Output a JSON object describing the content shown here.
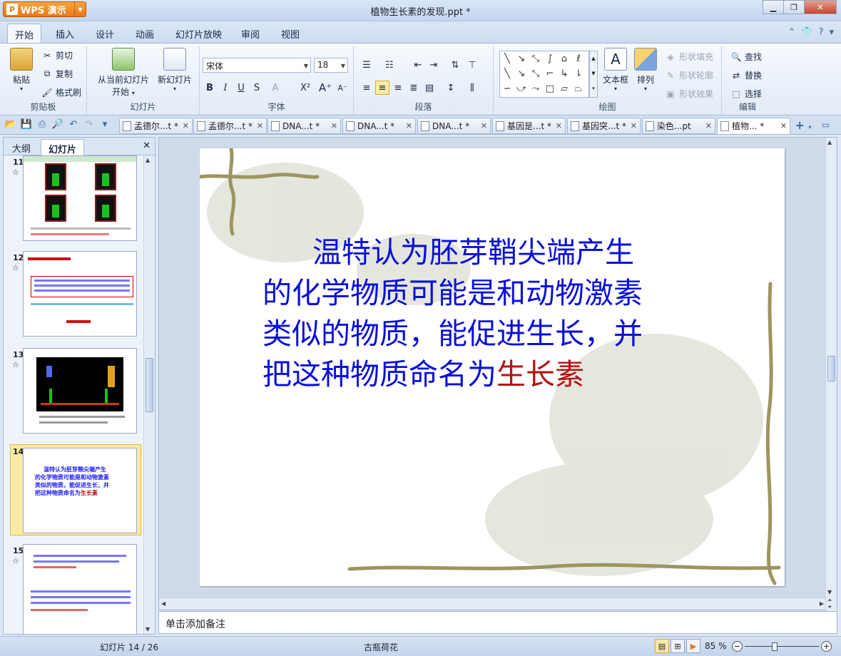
{
  "app": {
    "brand": "WPS 演示",
    "window_title": "植物生长素的发现.ppt *"
  },
  "ribbon_tabs": [
    "开始",
    "插入",
    "设计",
    "动画",
    "幻灯片放映",
    "审阅",
    "视图"
  ],
  "ribbon": {
    "clipboard": {
      "paste": "粘贴",
      "cut": "剪切",
      "copy": "复制",
      "format_painter": "格式刷",
      "label": "剪贴板"
    },
    "slides": {
      "from_current": "从当前幻灯片",
      "start": "开始",
      "new_slide": "新幻灯片",
      "label": "幻灯片"
    },
    "font": {
      "name": "宋体",
      "size": "18",
      "label": "字体"
    },
    "paragraph": {
      "label": "段落"
    },
    "drawing": {
      "textbox": "文本框",
      "arrange": "排列",
      "shape_fill": "形状填充",
      "shape_outline": "形状轮廓",
      "shape_effect": "形状效果",
      "label": "绘图"
    },
    "editing": {
      "find": "查找",
      "replace": "替换",
      "select": "选择",
      "label": "编辑"
    }
  },
  "doc_tabs": [
    {
      "label": "孟德尔...t *"
    },
    {
      "label": "孟德尔...t *"
    },
    {
      "label": "DNA...t *"
    },
    {
      "label": "DNA...t *"
    },
    {
      "label": "DNA...t *"
    },
    {
      "label": "基因是...t *"
    },
    {
      "label": "基因突...t *"
    },
    {
      "label": "染色...pt"
    },
    {
      "label": "植物... *"
    }
  ],
  "panel": {
    "tabs": [
      "大纲",
      "幻灯片"
    ]
  },
  "thumbnails": [
    {
      "number": "11",
      "star": "☆"
    },
    {
      "number": "12",
      "star": "☆"
    },
    {
      "number": "13",
      "star": "☆"
    },
    {
      "number": "14",
      "star": ""
    },
    {
      "number": "15",
      "star": "☆"
    }
  ],
  "slide": {
    "line1": "温特认为胚芽鞘尖端产生",
    "line2": "的化学物质可能是和动物激素",
    "line3": "类似的物质，能促进生长，并",
    "line4a": "把这种物质命名为",
    "line4b": "生长素"
  },
  "notes": {
    "placeholder": "单击添加备注"
  },
  "status": {
    "slide_info": "幻灯片 14 / 26",
    "theme": "古瓶荷花",
    "zoom": "85 %"
  },
  "colors": {
    "slide_text": "#0a10d8",
    "highlight": "#b11414",
    "accent": "#e8771a"
  }
}
